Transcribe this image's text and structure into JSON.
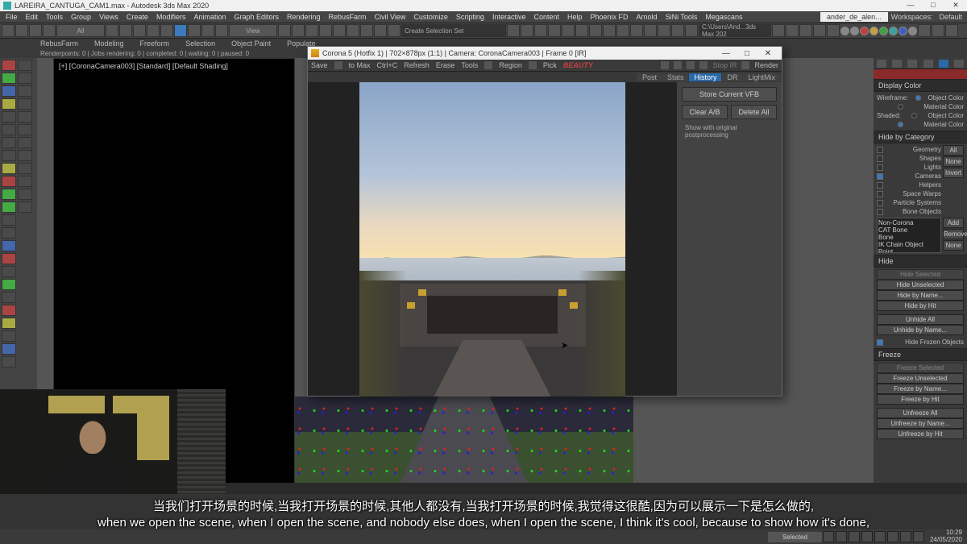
{
  "app": {
    "title": "LAREIRA_CANTUGA_CAM1.max - Autodesk 3ds Max 2020",
    "user": "ander_de_alen...",
    "workspace_label": "Workspaces:",
    "workspace_value": "Default"
  },
  "menu": [
    "File",
    "Edit",
    "Tools",
    "Group",
    "Views",
    "Create",
    "Modifiers",
    "Animation",
    "Graph Editors",
    "Rendering",
    "RebusFarm",
    "Civil View",
    "Customize",
    "Scripting",
    "Interactive",
    "Content",
    "Help",
    "Phoenix FD",
    "Arnold",
    "SiNi Tools",
    "Megascans"
  ],
  "toolbar": {
    "dropdown": "All",
    "view": "View",
    "selection_set": "Create Selection Set",
    "path": "C:\\Users\\And...3ds Max 202"
  },
  "ribbon": [
    "RebusFarm",
    "Modeling",
    "Freeform",
    "Selection",
    "Object Paint",
    "Populate"
  ],
  "status": "Renderpoints: 0 | Jobs rendering: 0 | completed: 0 | waiting: 0 | paused: 0",
  "viewport": {
    "label": "[+] [CoronaCamera003] [Standard] [Default Shading]"
  },
  "vfb": {
    "title": "Corona 5 (Hotfix 1) | 702×878px (1:1) | Camera: CoronaCamera003 | Frame 0 [IR]",
    "bar": {
      "save": "Save",
      "to_max": "to Max",
      "ctrlc": "Ctrl+C",
      "refresh": "Refresh",
      "erase": "Erase",
      "tools": "Tools",
      "region": "Region",
      "pick": "Pick",
      "beauty": "BEAUTY",
      "stop": "Stop IR",
      "render": "Render"
    },
    "tabs": [
      "Post",
      "Stats",
      "History",
      "DR",
      "LightMix"
    ],
    "active_tab": "History",
    "history": {
      "store": "Store Current VFB",
      "clear": "Clear A/B",
      "delete": "Delete All",
      "show_orig": "Show with original postprocessing"
    }
  },
  "rightpanel": {
    "display_color": {
      "title": "Display Color",
      "wireframe": "Wireframe:",
      "shaded": "Shaded:",
      "object_color": "Object Color",
      "material_color": "Material Color"
    },
    "hide_category": {
      "title": "Hide by Category",
      "items": [
        "Geometry",
        "Shapes",
        "Lights",
        "Cameras",
        "Helpers",
        "Space Warps",
        "Particle Systems",
        "Bone Objects"
      ],
      "checked": [
        "Cameras"
      ],
      "btns": {
        "all": "All",
        "none": "None",
        "invert": "Invert"
      },
      "list": [
        "Non-Corona",
        "CAT Bone",
        "Bone",
        "IK Chain Object",
        "Point"
      ],
      "list_btns": {
        "add": "Add",
        "remove": "Remove",
        "none2": "None"
      }
    },
    "hide": {
      "title": "Hide",
      "btns": [
        "Hide Selected",
        "Hide Unselected",
        "Hide by Name...",
        "Hide by Hit",
        "Unhide All",
        "Unhide by Name..."
      ],
      "frozen_chk": "Hide Frozen Objects"
    },
    "freeze": {
      "title": "Freeze",
      "btns": [
        "Freeze Selected",
        "Freeze Unselected",
        "Freeze by Name...",
        "Freeze by Hit",
        "Unfreeze All",
        "Unfreeze by Name...",
        "Unfreeze by Hit"
      ]
    }
  },
  "bottom": {
    "selected": "Selected",
    "time": "10:29",
    "date": "24/05/2020"
  },
  "subtitle": {
    "cn": "当我们打开场景的时候,当我打开场景的时候,其他人都没有,当我打开场景的时候,我觉得这很酷,因为可以展示一下是怎么做的,",
    "en": "when we open the scene, when I open the scene, and nobody else does, when I open the scene, I think it's cool, because to show how it's done,"
  }
}
